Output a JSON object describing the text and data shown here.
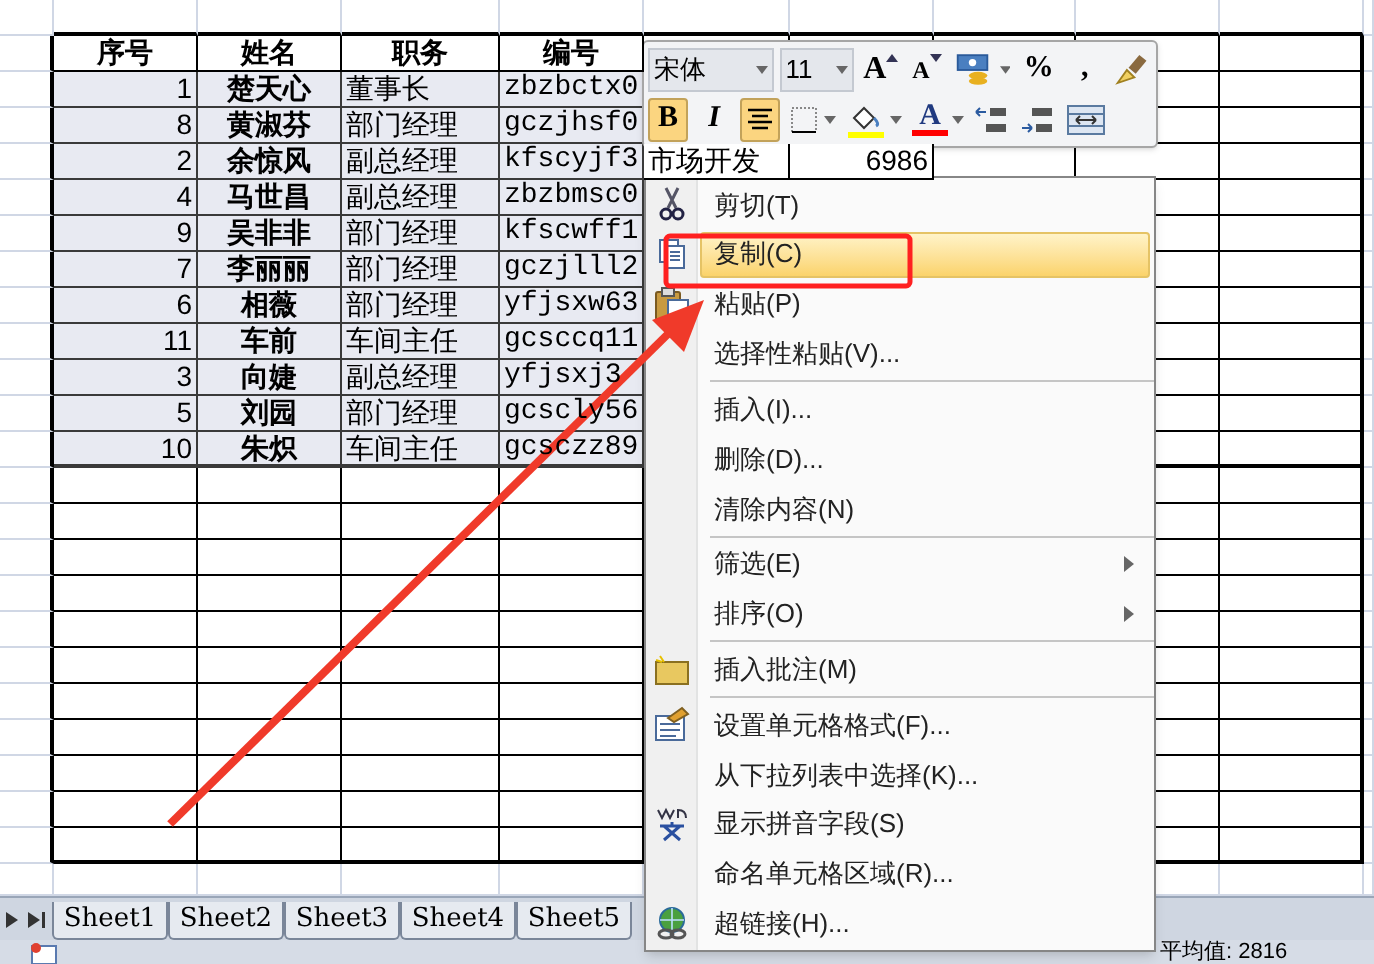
{
  "sheet": {
    "columns": [
      "序号",
      "姓名",
      "职务",
      "编号"
    ],
    "rows": [
      {
        "cells": [
          "1",
          "楚天心",
          "董事长",
          "zbzbctx0"
        ]
      },
      {
        "cells": [
          "8",
          "黄淑芬",
          "部门经理",
          "gczjhsf0"
        ]
      },
      {
        "cells": [
          "2",
          "余惊风",
          "副总经理",
          "kfscyjf3",
          "市场开发",
          "6986"
        ]
      },
      {
        "cells": [
          "4",
          "马世昌",
          "副总经理",
          "zbzbmsc0"
        ]
      },
      {
        "cells": [
          "9",
          "吴非非",
          "部门经理",
          "kfscwff1"
        ]
      },
      {
        "cells": [
          "7",
          "李丽丽",
          "部门经理",
          "gczjlll2"
        ]
      },
      {
        "cells": [
          "6",
          "相薇",
          "部门经理",
          "yfjsxw63"
        ]
      },
      {
        "cells": [
          "11",
          "车前",
          "车间主任",
          "gcsccq11"
        ]
      },
      {
        "cells": [
          "3",
          "向婕",
          "副总经理",
          "yfjsxj3"
        ]
      },
      {
        "cells": [
          "5",
          "刘园",
          "部门经理",
          "gcscly56"
        ]
      },
      {
        "cells": [
          "10",
          "朱炽",
          "车间主任",
          "gcsczz89"
        ]
      }
    ]
  },
  "mini_toolbar": {
    "font": "宋体",
    "size": "11",
    "row_1": [
      {
        "kind": "grow_font",
        "label": "A"
      },
      {
        "kind": "shrink_font",
        "label": "A"
      },
      {
        "kind": "accounting"
      },
      {
        "kind": "text",
        "label": "%"
      },
      {
        "kind": "text",
        "label": ","
      },
      {
        "kind": "painter"
      }
    ],
    "row_2": [
      {
        "kind": "text",
        "label": "B",
        "selected": true
      },
      {
        "kind": "text",
        "label": "I",
        "selected": false
      },
      {
        "kind": "align_center",
        "selected": true
      },
      {
        "kind": "borders"
      },
      {
        "kind": "fill_color",
        "color": "#ffff00"
      },
      {
        "kind": "font_color",
        "label": "A",
        "color": "#ff0000"
      },
      {
        "kind": "increase_decimal"
      },
      {
        "kind": "decrease_decimal"
      },
      {
        "kind": "merge"
      }
    ]
  },
  "context_menu": {
    "groups": [
      [
        {
          "label": "剪切(T)",
          "selected": false,
          "submenu": false
        },
        {
          "label": "复制(C)",
          "selected": true,
          "submenu": false
        },
        {
          "label": "粘贴(P)",
          "selected": false,
          "submenu": false
        },
        {
          "label": "选择性粘贴(V)...",
          "selected": false,
          "submenu": false
        }
      ],
      [
        {
          "label": "插入(I)...",
          "selected": false,
          "submenu": false
        },
        {
          "label": "删除(D)...",
          "selected": false,
          "submenu": false
        },
        {
          "label": "清除内容(N)",
          "selected": false,
          "submenu": false
        }
      ],
      [
        {
          "label": "筛选(E)",
          "selected": false,
          "submenu": true
        },
        {
          "label": "排序(O)",
          "selected": false,
          "submenu": true
        }
      ],
      [
        {
          "label": "插入批注(M)",
          "selected": false,
          "submenu": false
        }
      ],
      [
        {
          "label": "设置单元格格式(F)...",
          "selected": false,
          "submenu": false
        },
        {
          "label": "从下拉列表中选择(K)...",
          "selected": false,
          "submenu": false
        },
        {
          "label": "显示拼音字段(S)",
          "selected": false,
          "submenu": false
        },
        {
          "label": "命名单元格区域(R)...",
          "selected": false,
          "submenu": false
        },
        {
          "label": "超链接(H)...",
          "selected": false,
          "submenu": false
        }
      ]
    ]
  },
  "sheet_tabs": [
    {
      "label": "Sheet1",
      "selected": false
    },
    {
      "label": "Sheet2",
      "selected": false
    },
    {
      "label": "Sheet3",
      "selected": false
    },
    {
      "label": "Sheet4",
      "selected": false
    },
    {
      "label": "Sheet5",
      "selected": false
    }
  ],
  "status_bar": {
    "text": "平均值: 2816"
  }
}
